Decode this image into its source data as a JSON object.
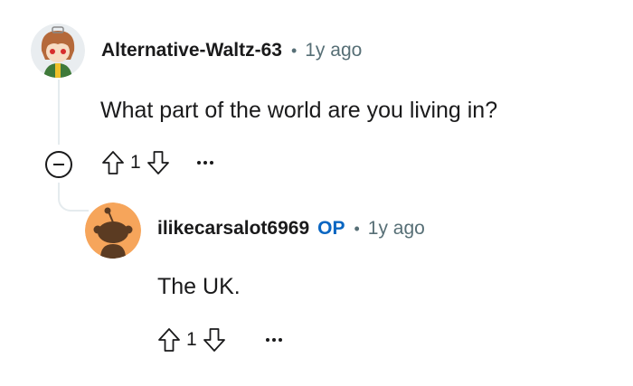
{
  "comments": [
    {
      "author": "Alternative-Waltz-63",
      "separator": "•",
      "time": "1y ago",
      "body": "What part of the world are you living in?",
      "score": "1"
    },
    {
      "author": "ilikecarsalot6969",
      "op_label": "OP",
      "separator": "•",
      "time": "1y ago",
      "body": "The UK.",
      "score": "1"
    }
  ],
  "icons": {
    "upvote": "arrow-up-outline",
    "downvote": "arrow-down-outline",
    "more": "ellipsis-horizontal",
    "collapse": "minus-circle"
  },
  "colors": {
    "op": "#0a66c2",
    "meta": "#576f76",
    "thread_line": "#e5ebee",
    "snoo_avatar_bg": "#f6a55b"
  }
}
